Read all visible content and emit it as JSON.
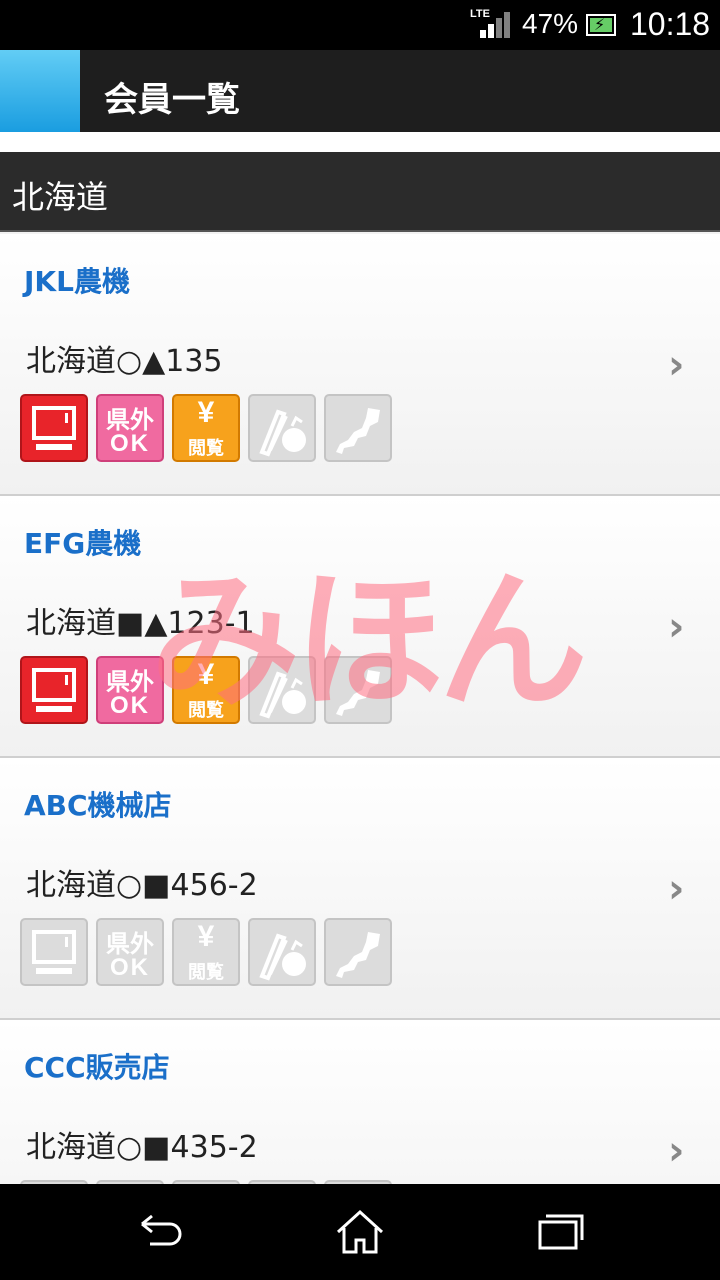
{
  "status_bar": {
    "network": "LTE",
    "battery": "47%",
    "time": "10:18"
  },
  "header": {
    "title": "会員一覧"
  },
  "section": {
    "label": "北海道"
  },
  "members": [
    {
      "name": "JKL農機",
      "address": "北海道○▲135",
      "icons": {
        "pc": true,
        "outside_ok": true,
        "price_view": true,
        "vegetable": false,
        "japan_map": false
      }
    },
    {
      "name": "EFG農機",
      "address": "北海道■▲123-1",
      "icons": {
        "pc": true,
        "outside_ok": true,
        "price_view": true,
        "vegetable": false,
        "japan_map": false
      }
    },
    {
      "name": "ABC機械店",
      "address": "北海道○■456-2",
      "icons": {
        "pc": false,
        "outside_ok": false,
        "price_view": false,
        "vegetable": false,
        "japan_map": false
      }
    },
    {
      "name": "CCC販売店",
      "address": "北海道○■435-2",
      "icons": {
        "pc": false,
        "outside_ok": false,
        "price_view": false,
        "vegetable": false,
        "japan_map": false
      }
    }
  ],
  "icon_labels": {
    "outside_top": "県外",
    "outside_bottom": "OK",
    "yen": "¥",
    "view": "閲覧"
  },
  "watermark": "みほん",
  "nav": {
    "back": "back-icon",
    "home": "home-icon",
    "recents": "recents-icon"
  },
  "colors": {
    "accent": "#1a9de0",
    "name": "#1a6fc9",
    "pc_on": "#e8242a",
    "ok_on": "#f06aa0",
    "yen_on": "#f7a21c",
    "off": "#dcdcdc"
  }
}
